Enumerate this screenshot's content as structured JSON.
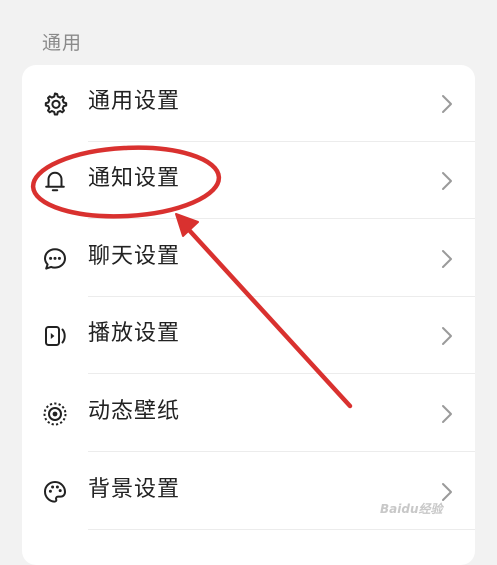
{
  "section": {
    "title": "通用"
  },
  "settings": {
    "items": [
      {
        "label": "通用设置",
        "icon": "gear-icon"
      },
      {
        "label": "通知设置",
        "icon": "bell-icon"
      },
      {
        "label": "聊天设置",
        "icon": "chat-bubble-icon"
      },
      {
        "label": "播放设置",
        "icon": "play-device-icon"
      },
      {
        "label": "动态壁纸",
        "icon": "live-wallpaper-icon"
      },
      {
        "label": "背景设置",
        "icon": "palette-icon"
      }
    ]
  },
  "annotation": {
    "color": "#d9312f"
  },
  "watermark": {
    "text": "Baidu经验"
  }
}
